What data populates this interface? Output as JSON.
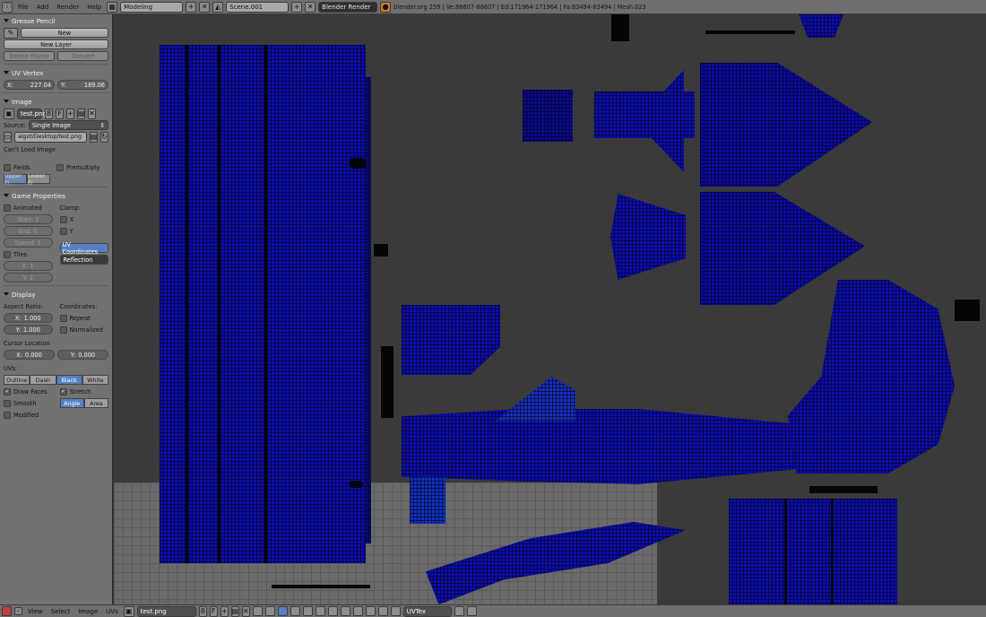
{
  "topbar": {
    "menus": [
      "File",
      "Add",
      "Render",
      "Help"
    ],
    "screen_layout": "Modeling",
    "scene": "Scene.001",
    "render_engine": "Blender Render",
    "stats": "blender.org 259 | Ve:88607-88607 | Ed:171964-171964 | Fa:83494-83494 | Mesh.023"
  },
  "grease_pencil": {
    "header": "Grease Pencil",
    "new_label": "New",
    "new_layer_label": "New Layer",
    "delete_frame_label": "Delete Frame",
    "convert_label": "Convert"
  },
  "uv_vertex": {
    "header": "UV Vertex",
    "x_label": "X:",
    "x_value": "227.04",
    "y_label": "Y:",
    "y_value": "189.06"
  },
  "image": {
    "header": "Image",
    "name": "test.png",
    "users": "8",
    "fake_label": "F",
    "source_label": "Source:",
    "source_value": "Single Image",
    "filepath": "algot/Desktop/test.png",
    "status": "Can't Load Image",
    "fields_label": "Fields",
    "premultiply_label": "Premultiply",
    "upper_label": "Upper Fi",
    "lower_label": "Lower Fi"
  },
  "game_properties": {
    "header": "Game Properties",
    "animated_label": "Animated",
    "clamp_label": "Clamp:",
    "start_label": "Start:",
    "start_value": "0",
    "end_label": "End:",
    "end_value": "0",
    "speed_label": "Speed:",
    "speed_value": "1",
    "clamp_x": "X",
    "clamp_y": "Y",
    "tiles_label": "Tiles",
    "uv_coordinates_label": "UV Coordinates",
    "reflection_label": "Reflection",
    "tx_label": "X:",
    "tx_value": "1",
    "ty_label": "Y:",
    "ty_value": "1"
  },
  "display": {
    "header": "Display",
    "aspect_label": "Aspect Ratio:",
    "coordinates_label": "Coordinates:",
    "ax_label": "X:",
    "ax_value": "1.000",
    "ay_label": "Y:",
    "ay_value": "1.000",
    "repeat_label": "Repeat",
    "normalized_label": "Normalized",
    "cursor_label": "Cursor Location",
    "cx_label": "X:",
    "cx_value": "0.000",
    "cy_label": "Y:",
    "cy_value": "0.000",
    "uvs_label": "UVs:",
    "uv_modes": [
      "Outline",
      "Dash",
      "Black",
      "White"
    ],
    "uv_mode_active": "Black",
    "draw_faces_label": "Draw Faces",
    "stretch_label": "Stretch",
    "smooth_label": "Smooth",
    "angle_label": "Angle",
    "area_label": "Area",
    "modified_label": "Modified"
  },
  "bottombar": {
    "menus": [
      "View",
      "Select",
      "Image",
      "UVs"
    ],
    "image_name": "test.png",
    "users": "8",
    "fake_label": "F",
    "uv_map": "UVTex"
  },
  "colors": {
    "mesh_face": "#0d0db0",
    "mesh_edge": "#000000",
    "selected_button": "#5680c2",
    "background": "#3a3a3a"
  }
}
